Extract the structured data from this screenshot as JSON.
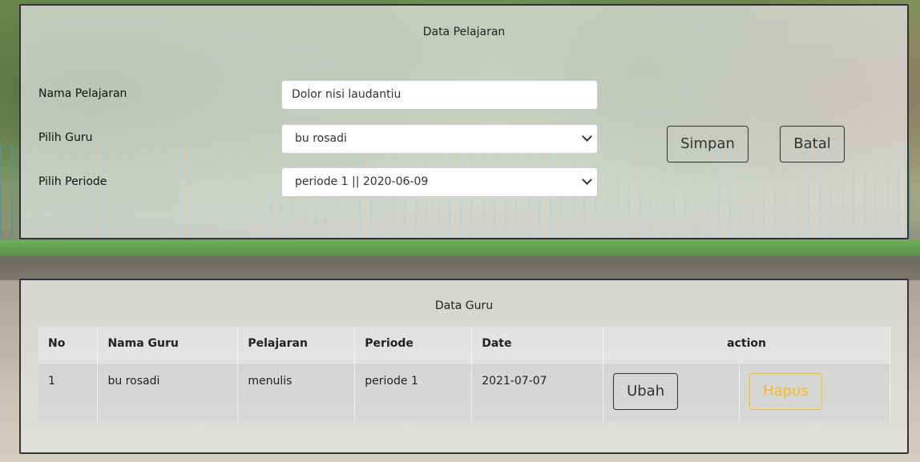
{
  "form": {
    "title": "Data Pelajaran",
    "nama_pelajaran_label": "Nama Pelajaran",
    "nama_pelajaran_value": "Dolor nisi laudantiu",
    "pilih_guru_label": "Pilih Guru",
    "pilih_guru_value": "bu rosadi",
    "pilih_periode_label": "Pilih Periode",
    "pilih_periode_value": "periode 1 || 2020-06-09",
    "simpan_label": "Simpan",
    "batal_label": "Batal"
  },
  "table": {
    "title": "Data Guru",
    "headers": [
      "No",
      "Nama Guru",
      "Pelajaran",
      "Periode",
      "Date",
      "action"
    ],
    "rows": [
      {
        "no": "1",
        "nama_guru": "bu rosadi",
        "pelajaran": "menulis",
        "periode": "periode 1",
        "date": "2021-07-07",
        "ubah_label": "Ubah",
        "hapus_label": "Hapus"
      }
    ]
  },
  "colors": {
    "panel_border": "#333333",
    "hapus_accent": "#f0c020"
  }
}
